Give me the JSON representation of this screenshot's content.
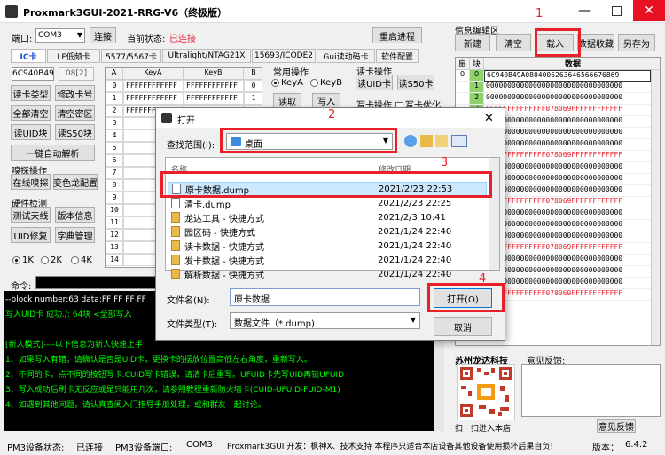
{
  "window": {
    "title": "Proxmark3GUI-2021-RRG-V6（终极版）"
  },
  "toolbar": {
    "port_label": "端口:",
    "port_value": "COM3",
    "connect_label": "连接",
    "state_label": "当前状态:",
    "state_value": "已连接",
    "restart_label": "重启进程"
  },
  "tabs": [
    "IC卡",
    "LF低频卡",
    "5577/5567卡",
    "Ultralight/NTAG21X",
    "15693/ICODE2",
    "Gui读动码卡",
    "软件配置"
  ],
  "ic": {
    "uid": "6C940B49",
    "sak": "08[2]",
    "buttons": [
      "读卡类型",
      "修改卡号",
      "全部清空",
      "清空密区",
      "读UID块",
      "读S50块"
    ],
    "auto_label": "一键自动解析",
    "sniff_group": "嗅探操作",
    "sniff_buttons": [
      "在线嗅探",
      "变色龙配置"
    ],
    "hw_group": "硬件检测",
    "hw_buttons": [
      "测试天线",
      "版本信息",
      "UID修复",
      "字典管理"
    ],
    "sizes": [
      "1K",
      "2K",
      "4K"
    ]
  },
  "key_table": {
    "headers": [
      "A",
      "KeyA",
      "KeyB",
      "B"
    ],
    "rows": [
      {
        "idx": "0",
        "a": "FFFFFFFFFFFF",
        "b": "FFFFFFFFFFFF",
        "n": "0"
      },
      {
        "idx": "1",
        "a": "FFFFFFFFFFFF",
        "b": "FFFFFFFFFFFF",
        "n": "1"
      },
      {
        "idx": "2",
        "a": "FFFFFFFFFFFF",
        "b": "",
        "n": ""
      },
      {
        "idx": "3",
        "a": "",
        "b": "",
        "n": ""
      },
      {
        "idx": "4",
        "a": "",
        "b": "",
        "n": ""
      },
      {
        "idx": "5",
        "a": "",
        "b": "",
        "n": ""
      },
      {
        "idx": "6",
        "a": "",
        "b": "",
        "n": ""
      },
      {
        "idx": "7",
        "a": "",
        "b": "",
        "n": ""
      },
      {
        "idx": "8",
        "a": "",
        "b": "",
        "n": ""
      },
      {
        "idx": "9",
        "a": "",
        "b": "",
        "n": ""
      },
      {
        "idx": "10",
        "a": "",
        "b": "",
        "n": ""
      },
      {
        "idx": "11",
        "a": "",
        "b": "",
        "n": ""
      },
      {
        "idx": "12",
        "a": "",
        "b": "",
        "n": ""
      },
      {
        "idx": "13",
        "a": "",
        "b": "",
        "n": ""
      },
      {
        "idx": "14",
        "a": "",
        "b": "",
        "n": ""
      }
    ]
  },
  "common_ops": {
    "label": "常用操作",
    "key_a": "KeyA",
    "key_b": "KeyB",
    "read": "读取",
    "write": "写入"
  },
  "read_ops": {
    "label": "读卡操作",
    "uid": "读UID卡",
    "s50": "读S50卡"
  },
  "write_ops": {
    "label": "写卡操作",
    "optimize": "写卡优化"
  },
  "command": {
    "label": "命令:"
  },
  "console": {
    "lines": [
      {
        "text": "--block number:63 data:FF FF FF FF",
        "color": "#ffffff"
      },
      {
        "text": "写入UID卡      成功./: 64块  <全部写入",
        "color": "#00ff00"
      },
      {
        "text": "",
        "color": "#ffffff"
      },
      {
        "text": "[新人模式]----以下信息为新人快速上手",
        "color": "#00ff00"
      },
      {
        "text": "        1、如果写入有错，请确认是否是UID卡，更换卡的摆放位置高低左右角度，重新写入。",
        "color": "#00ff00"
      },
      {
        "text": "        2、不同的卡，点不同的按钮写卡.CUID写卡错误，请清卡后重写。UFUID卡先写UID再锁UFUID",
        "color": "#00ff00"
      },
      {
        "text": "        3、写入成功后刷卡无反应或是只能用几次，请参照教程重新防火墙卡(CUID-UFUID-FUID-M1)",
        "color": "#00ff00"
      },
      {
        "text": "        4、如遇到其他问题，请认真查阅入门指导手册处理，或和群友一起讨论。",
        "color": "#00ff00"
      }
    ]
  },
  "info_panel": {
    "title": "信息编辑区",
    "buttons": [
      "新建",
      "清空",
      "载入",
      "数据收藏",
      "另存为"
    ],
    "headers": [
      "扇",
      "块",
      "数据"
    ],
    "rows": [
      {
        "s": "0",
        "b": "0",
        "d": "6C940B49A0804006263646566676869"
      },
      {
        "s": "",
        "b": "1",
        "d": "00000000000000000000000000000000"
      },
      {
        "s": "",
        "b": "2",
        "d": "00000000000000000000000000000000"
      },
      {
        "s": "",
        "b": "3",
        "d": "FFFFFFFFFFFFFF078069FFFFFFFFFFFF"
      },
      {
        "s": "1",
        "b": "4",
        "d": "00000000000000000000000000000000"
      },
      {
        "s": "",
        "b": "5",
        "d": "00000000000000000000000000000000"
      },
      {
        "s": "",
        "b": "6",
        "d": "00000000000000000000000000000000"
      },
      {
        "s": "",
        "b": "7",
        "d": "FFFFFFFFFFFFFF078069FFFFFFFFFFFF"
      },
      {
        "s": "2",
        "b": "8",
        "d": "00000000000000000000000000000000"
      },
      {
        "s": "",
        "b": "9",
        "d": "00000000000000000000000000000000"
      },
      {
        "s": "",
        "b": "10",
        "d": "00000000000000000000000000000000"
      },
      {
        "s": "",
        "b": "11",
        "d": "FFFFFFFFFFFFFF078069FFFFFFFFFFFF"
      },
      {
        "s": "3",
        "b": "12",
        "d": "00000000000000000000000000000000"
      },
      {
        "s": "",
        "b": "13",
        "d": "00000000000000000000000000000000"
      },
      {
        "s": "",
        "b": "14",
        "d": "00000000000000000000000000000000"
      },
      {
        "s": "",
        "b": "15",
        "d": "FFFFFFFFFFFFFF078069FFFFFFFFFFFF"
      },
      {
        "s": "4",
        "b": "16",
        "d": "00000000000000000000000000000000"
      },
      {
        "s": "",
        "b": "17",
        "d": "00000000000000000000000000000000"
      },
      {
        "s": "",
        "b": "18",
        "d": "00000000000000000000000000000000"
      },
      {
        "s": "",
        "b": "19",
        "d": "FFFFFFFFFFFFFF078069FFFFFFFFFFFF"
      }
    ]
  },
  "store": {
    "title": "苏州龙达科技",
    "feedback_label": "意见反馈:",
    "scan_label": "扫一扫进入本店",
    "feedback_button": "意见反馈"
  },
  "statusbar": {
    "state_label": "PM3设备状态:",
    "state_value": "已连接",
    "port_label": "PM3设备端口:",
    "port_value": "COM3",
    "credits": "Proxmark3GUI 开发：枫神X、技术支持  本程序只适合本店设备其他设备使用损坏后果自负!",
    "version_label": "版本：",
    "version_value": "6.4.2"
  },
  "dialog": {
    "title": "打开",
    "lookin_label": "查找范围(I):",
    "lookin_value": "桌面",
    "col_name": "名称",
    "col_date": "修改日期",
    "files": [
      {
        "name": "原卡数据.dump",
        "date": "2021/2/23 22:53",
        "icon": "file"
      },
      {
        "name": "清卡.dump",
        "date": "2021/2/23 22:25",
        "icon": "file"
      },
      {
        "name": "龙达工具 - 快捷方式",
        "date": "2021/2/3 10:41",
        "icon": "shortcut"
      },
      {
        "name": "园区码 - 快捷方式",
        "date": "2021/1/24 22:40",
        "icon": "shortcut"
      },
      {
        "name": "读卡数据 - 快捷方式",
        "date": "2021/1/24 22:40",
        "icon": "shortcut"
      },
      {
        "name": "发卡数据 - 快捷方式",
        "date": "2021/1/24 22:40",
        "icon": "shortcut"
      },
      {
        "name": "解析数据 - 快捷方式",
        "date": "2021/1/24 22:40",
        "icon": "shortcut"
      }
    ],
    "filename_label": "文件名(N):",
    "filename_value": "原卡数据",
    "filetype_label": "文件类型(T):",
    "filetype_value": "数据文件（*.dump)",
    "open_label": "打开(O)",
    "cancel_label": "取消"
  },
  "annotations": [
    "1",
    "2",
    "3",
    "4"
  ]
}
